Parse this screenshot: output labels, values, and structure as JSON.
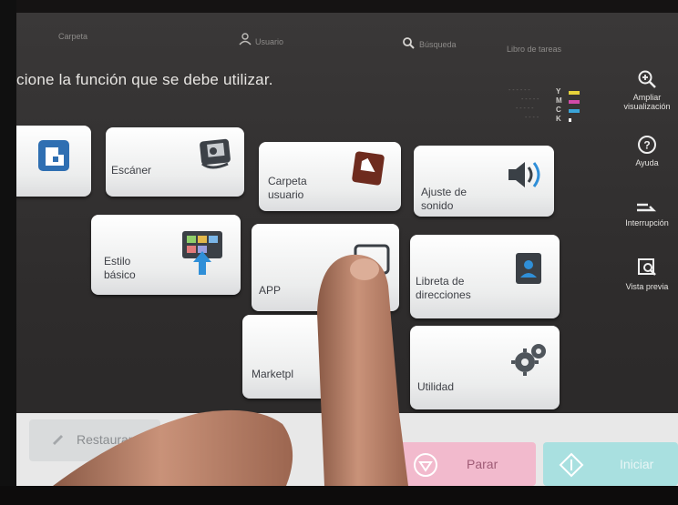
{
  "topbar": {
    "left_text": "Carpeta",
    "user_text": "Usuario",
    "search_text": "Búsqueda",
    "right_text": "Libro de tareas"
  },
  "instruction": "cione la función que se debe utilizar.",
  "toner": {
    "labels": [
      "Y",
      "M",
      "C",
      "K"
    ],
    "colors": {
      "Y": "#e6d23a",
      "M": "#d14aa8",
      "C": "#3aa4d8",
      "K": "#f2f2f2"
    }
  },
  "tiles": {
    "partial": "",
    "escaner": "Escáner",
    "carpeta": "Carpeta\nusuario",
    "ajuste": "Ajuste de\nsonido",
    "estilo": "Estilo\nbásico",
    "app": "APP",
    "libreta": "Libreta de\ndirecciones",
    "marketplace": "Marketpl",
    "utilidad": "Utilidad"
  },
  "side": {
    "ampliar": "Ampliar\nvisualización",
    "ayuda": "Ayuda",
    "interrupcion": "Interrupción",
    "vista": "Vista previa"
  },
  "bottom": {
    "restaurar": "Restaurar",
    "parar": "Parar",
    "iniciar": "Iniciar"
  },
  "icons": {
    "partial": "share-icon",
    "escaner": "scanner-icon",
    "carpeta": "user-folder-icon",
    "ajuste": "speaker-icon",
    "estilo": "basic-style-icon",
    "app": "app-icon",
    "libreta": "address-book-icon",
    "utilidad": "gears-icon",
    "ampliar": "zoom-in-icon",
    "ayuda": "help-icon",
    "interrupcion": "interrupt-icon",
    "vista": "preview-icon",
    "restaurar": "reset-icon",
    "parar": "stop-icon",
    "iniciar": "start-icon"
  }
}
